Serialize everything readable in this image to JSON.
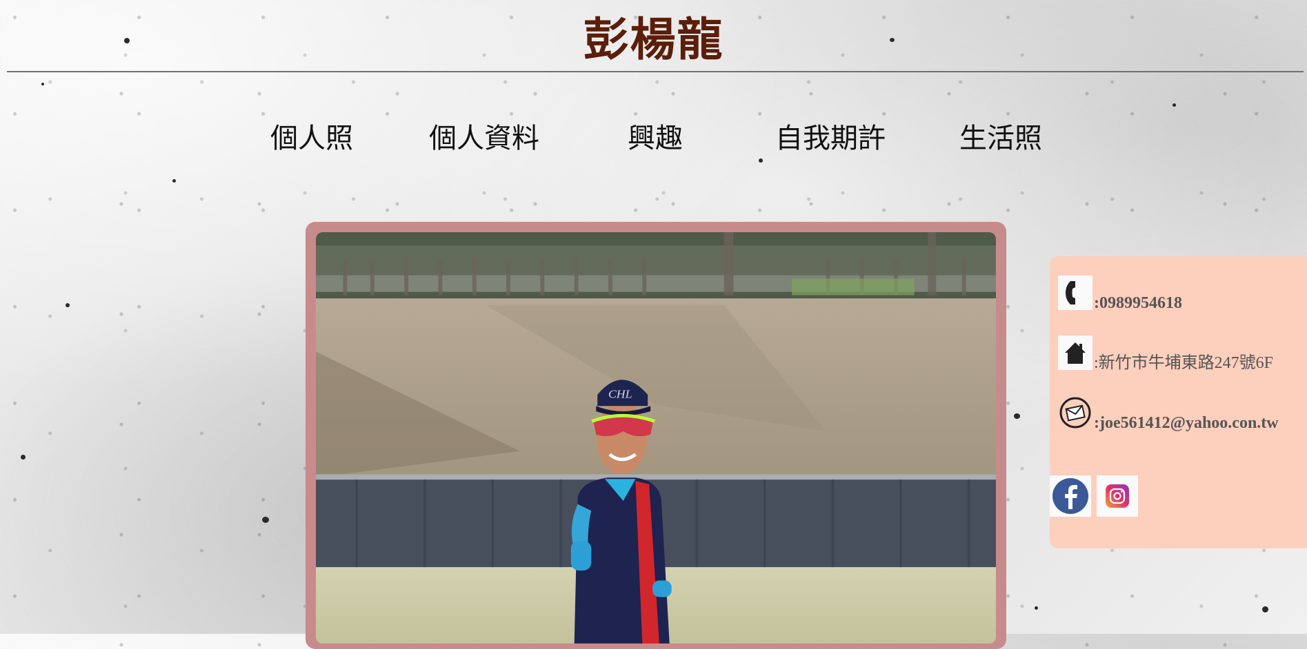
{
  "header": {
    "title": "彭楊龍"
  },
  "nav": {
    "items": [
      {
        "label": "個人照"
      },
      {
        "label": "個人資料"
      },
      {
        "label": "興趣"
      },
      {
        "label": "自我期許"
      },
      {
        "label": "生活照"
      }
    ]
  },
  "contact": {
    "phone": ":0989954618",
    "address": ":新竹市牛埔東路247號6F",
    "email": ":joe561412@yahoo.con.tw",
    "icons": [
      "phone-icon",
      "home-icon",
      "mail-icon"
    ]
  },
  "social": {
    "icons": [
      "facebook-icon",
      "instagram-icon"
    ]
  },
  "colors": {
    "title": "#5a1e0a",
    "frame": "#c88b8b",
    "panel": "#fdcfbd",
    "facebook": "#3b5998"
  }
}
